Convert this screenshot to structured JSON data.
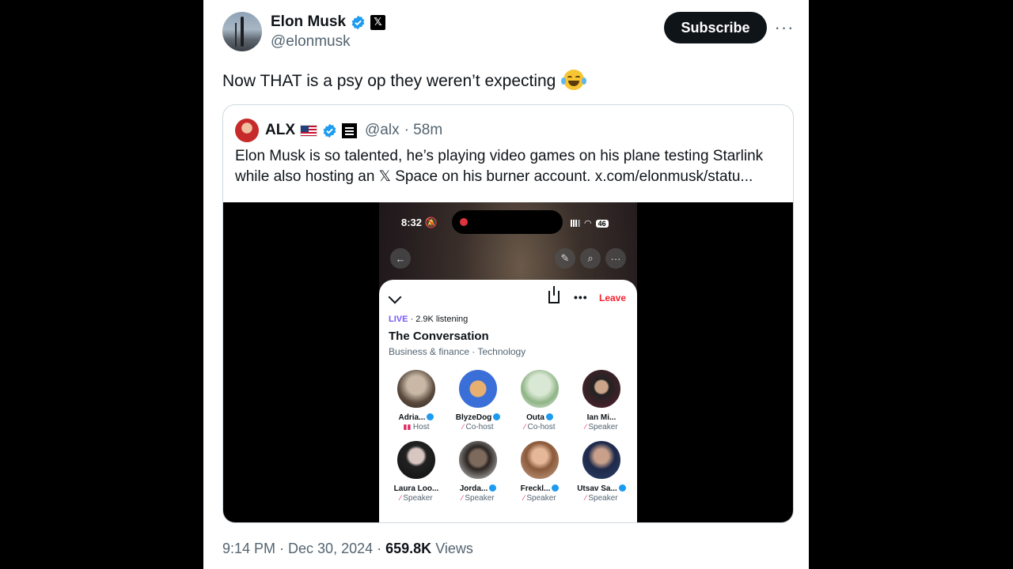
{
  "author": {
    "name": "Elon Musk",
    "handle": "@elonmusk"
  },
  "actions": {
    "subscribe_label": "Subscribe",
    "more_label": "···"
  },
  "tweet": {
    "text": "Now THAT is a psy op they weren’t expecting",
    "emoji": "face-with-tears-of-joy"
  },
  "quote": {
    "name": "ALX",
    "handle": "@alx",
    "age": "· 58m",
    "text": "Elon Musk is so talented, he’s playing video games on his plane testing Starlink while also hosting an 𝕏 Space on his burner account.  x.com/elonmusk/statu..."
  },
  "phone": {
    "time": "8:32",
    "battery": "46",
    "leave_label": "Leave",
    "live_label": "LIVE",
    "listening": "· 2.9K listening",
    "space_title": "The Conversation",
    "space_topics": "Business & finance · Technology",
    "speakers": [
      {
        "name": "Adria...",
        "role": "Host"
      },
      {
        "name": "BlyzeDog",
        "role": "Co-host"
      },
      {
        "name": "Outa",
        "role": "Co-host"
      },
      {
        "name": "Ian Mi...",
        "role": "Speaker"
      },
      {
        "name": "Laura Loo...",
        "role": "Speaker"
      },
      {
        "name": "Jorda...",
        "role": "Speaker"
      },
      {
        "name": "Freckl...",
        "role": "Speaker"
      },
      {
        "name": "Utsav Sa...",
        "role": "Speaker"
      }
    ]
  },
  "meta": {
    "time": "9:14 PM · Dec 30, 2024 ·",
    "views_count": "659.8K",
    "views_label": "Views"
  },
  "colors": {
    "verified": "#1d9bf0",
    "leave": "#f4212e",
    "live": "#7856ff"
  }
}
